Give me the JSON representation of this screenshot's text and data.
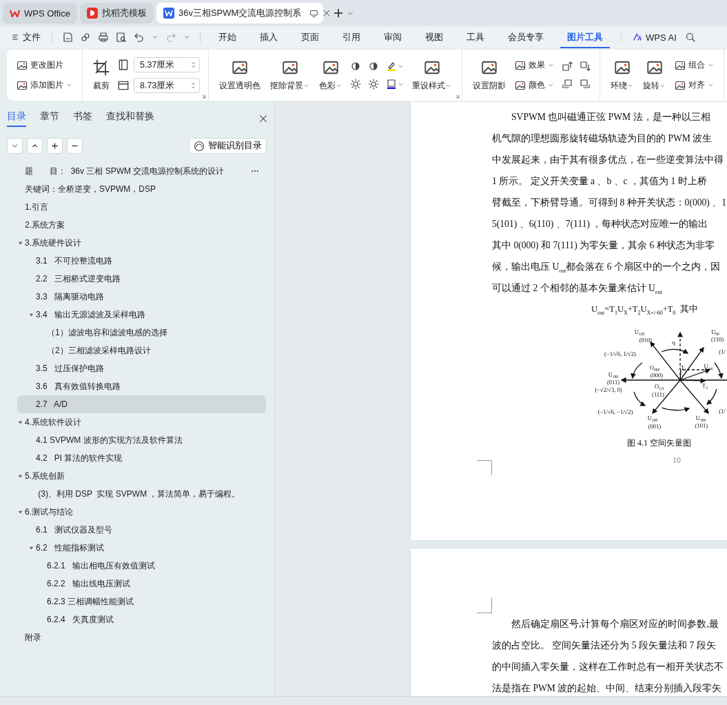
{
  "window_tabs": [
    {
      "kind": "home",
      "label": "WPS Office",
      "selected": false
    },
    {
      "kind": "template",
      "label": "找稻壳模板",
      "selected": false
    },
    {
      "kind": "document",
      "label": "36v三相SPWM交流电源控制系",
      "selected": true
    }
  ],
  "menu": {
    "file": "文件",
    "items": [
      {
        "label": "开始",
        "selected": false
      },
      {
        "label": "插入",
        "selected": false
      },
      {
        "label": "页面",
        "selected": false
      },
      {
        "label": "引用",
        "selected": false
      },
      {
        "label": "审阅",
        "selected": false
      },
      {
        "label": "视图",
        "selected": false
      },
      {
        "label": "工具",
        "selected": false
      },
      {
        "label": "会员专享",
        "selected": false
      },
      {
        "label": "图片工具",
        "selected": true
      }
    ],
    "ai": "WPS AI"
  },
  "ribbon": {
    "groups": [
      {
        "launcher": false,
        "items": [
          {
            "kind": "stack",
            "items": [
              {
                "label": "更改图片",
                "dropdown": false
              },
              {
                "label": "添加图片",
                "dropdown": true
              }
            ]
          }
        ]
      },
      {
        "launcher": true,
        "items": [
          {
            "kind": "large",
            "label": "裁剪",
            "dropdown": false
          },
          {
            "kind": "fields",
            "items": [
              {
                "value": "5.37厘米"
              },
              {
                "value": "8.73厘米"
              }
            ]
          }
        ]
      },
      {
        "launcher": true,
        "items": [
          {
            "kind": "large",
            "label": "设置透明色",
            "dropdown": false
          },
          {
            "kind": "large",
            "label": "抠除背景",
            "dropdown": true
          },
          {
            "kind": "large",
            "label": "色彩",
            "dropdown": true
          },
          {
            "kind": "icons",
            "items": [
              {
                "dropdown": false
              },
              {
                "dropdown": false
              },
              {
                "dropdown": false
              },
              {
                "dropdown": false
              },
              {
                "dropdown": true
              },
              {
                "dropdown": true
              }
            ]
          },
          {
            "kind": "large",
            "label": "重设样式",
            "dropdown": true
          }
        ]
      },
      {
        "launcher": false,
        "items": [
          {
            "kind": "large",
            "label": "设置阴影",
            "dropdown": false
          },
          {
            "kind": "stack",
            "items": [
              {
                "label": "效果",
                "dropdown": true
              },
              {
                "label": "颜色",
                "dropdown": true
              }
            ]
          },
          {
            "kind": "icons",
            "items": [
              {
                "dropdown": false
              },
              {
                "dropdown": false
              },
              {
                "dropdown": false
              },
              {
                "dropdown": false
              }
            ]
          }
        ]
      },
      {
        "launcher": false,
        "items": [
          {
            "kind": "large",
            "label": "环绕",
            "dropdown": true
          },
          {
            "kind": "large",
            "label": "旋转",
            "dropdown": true
          },
          {
            "kind": "stack",
            "items": [
              {
                "label": "组合",
                "dropdown": true
              },
              {
                "label": "对齐",
                "dropdown": true
              }
            ]
          }
        ]
      }
    ]
  },
  "sidebar": {
    "tabs": [
      {
        "label": "目录",
        "selected": true
      },
      {
        "label": "章节",
        "selected": false
      },
      {
        "label": "书签",
        "selected": false
      },
      {
        "label": "查找和替换",
        "selected": false
      }
    ],
    "smart_button": "智能识别目录",
    "toc": [
      {
        "label": "题　　目：  36v 三相 SPWM 交流电源控制系统的设计",
        "selected": false
      },
      {
        "label": "关键词：全桥逆变，SVPWM，DSP",
        "selected": false
      },
      {
        "label": "1.引言",
        "selected": false
      },
      {
        "label": "2.系统方案",
        "selected": false
      },
      {
        "label": "3.系统硬件设计",
        "selected": false,
        "expanded": true,
        "children": [
          {
            "label": "3.1   不可控整流电路",
            "selected": false
          },
          {
            "label": "2.2   三相桥式逆变电路",
            "selected": false
          },
          {
            "label": "3.3   隔离驱动电路",
            "selected": false
          },
          {
            "label": "3.4   输出无源滤波及采样电路",
            "selected": false,
            "expanded": true,
            "children": [
              {
                "label": "（1）滤波电容和滤波电感的选择",
                "selected": false
              },
              {
                "label": "（2）三相滤波采样电路设计",
                "selected": false
              }
            ]
          },
          {
            "label": "3.5   过压保护电路",
            "selected": false
          },
          {
            "label": "3.6   真有效值转换电路",
            "selected": false
          },
          {
            "label": "2.7   A/D",
            "selected": true
          }
        ]
      },
      {
        "label": "4.系统软件设计",
        "selected": false,
        "expanded": true,
        "children": [
          {
            "label": "4.1 SVPWM 波形的实现方法及软件算法",
            "selected": false
          },
          {
            "label": "4.2   PI 算法的软件实现",
            "selected": false
          }
        ]
      },
      {
        "label": "5.系统创新",
        "selected": false,
        "expanded": true,
        "children": [
          {
            "label": " (3)、利用 DSP  实现 SVPWM ，算法简单，易于编程。",
            "selected": false
          }
        ]
      },
      {
        "label": "6.测试与结论",
        "selected": false,
        "expanded": true,
        "children": [
          {
            "label": "6.1   测试仪器及型号",
            "selected": false
          },
          {
            "label": "6.2   性能指标测试",
            "selected": false,
            "expanded": true,
            "children": [
              {
                "label": "6.2.1   输出相电压有效值测试",
                "selected": false
              },
              {
                "label": "6.2.2   输出线电压测试",
                "selected": false
              },
              {
                "label": "6.2.3 三相调幅性能测试",
                "selected": false
              },
              {
                "label": "6.2.4   失真度测试",
                "selected": false
              }
            ]
          }
        ]
      },
      {
        "label": "附录",
        "selected": false
      }
    ]
  },
  "document": {
    "page1": {
      "lines": [
        "SVPWM 也叫磁通正弦 PWM 法，是一种以三相",
        "机气隙的理想圆形旋转磁场轨迹为目的的 PWM 波生",
        "中发展起来，由于其有很多优点，在一些逆变算法中得",
        "1 所示。 定义开关变量 a 、b 、c ，其值为 1 时上桥",
        "臂截至，下桥臂导通。可得到 8 种开关状态：0(000) 、1",
        "5(101) 、6(110) 、7(111) ，每种状态对应唯一的输出",
        "其中 0(000) 和 7(111) 为零矢量，其余 6 种状态为非零",
        "候，输出电压 U$_{out}$都会落在 6 个扇区中的一个之内，因",
        "可以通过 2 个相邻的基本矢量来估计 U$_{out}$"
      ],
      "equation": "U$_{out}$=T$_{1}$U$_{X}$+T$_{2}$U$_{X+/-60}$+T$_{0}$  其中",
      "figure_labels": [
        "U$_{120}$",
        "(010)",
        "q",
        "U$_{60}$",
        "(110)",
        "(−1/√6, 1/√2)",
        "(1/",
        "O$_{000}$",
        "(000)",
        "T$_{1}$",
        "U$_{out}$",
        "U$_{180}$",
        "(011)",
        "(−√2/√3, 0)",
        "O$_{111}$",
        "(111)",
        "T$_{2}$",
        "(−1/√6, −1/√2)",
        "(1/",
        "U$_{240}$",
        "(001)",
        "U$_{300}$",
        "(101)"
      ],
      "caption": "图 4.1 空间矢量图",
      "page_number": "10"
    },
    "page2": {
      "lines": [
        "然后确定扇区号,计算每个扇区对应的时间参数,最",
        "波的占空比。 空间矢量法还分为 5 段矢量法和 7 段矢",
        "的中间插入零矢量，这样在工作时总有一相开关状态不",
        "法是指在 PWM 波的起始、中间、结束分别插入段零矢"
      ]
    }
  }
}
